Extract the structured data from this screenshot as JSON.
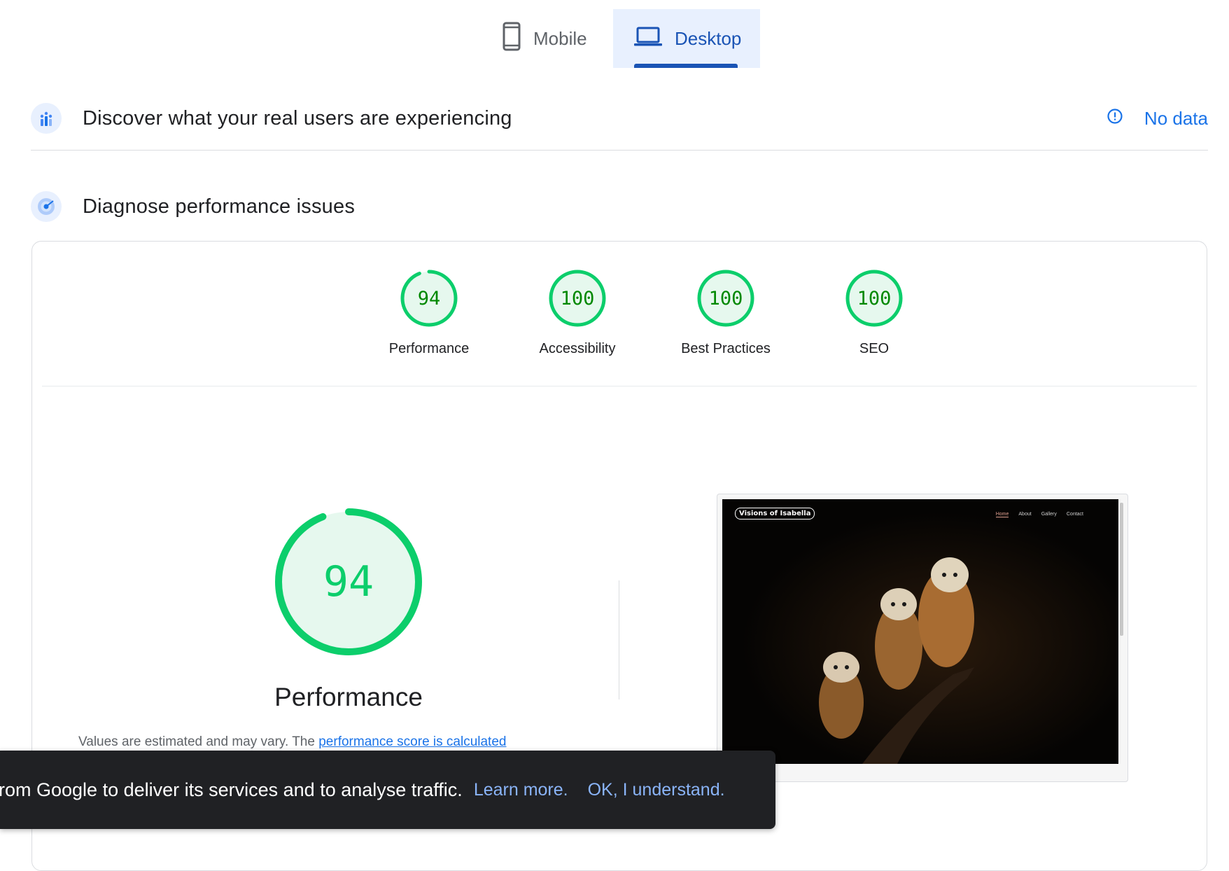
{
  "device_tabs": {
    "mobile_label": "Mobile",
    "desktop_label": "Desktop",
    "active": "Desktop",
    "icons": {
      "mobile": "smartphone-icon",
      "desktop": "laptop-icon"
    }
  },
  "crux": {
    "title": "Discover what your real users are experiencing",
    "status_text": "No data",
    "icons": {
      "section": "bar-chart-people-icon",
      "status": "info-icon"
    }
  },
  "diagnose": {
    "title": "Diagnose performance issues",
    "icon": "radar-icon"
  },
  "categories": [
    {
      "score": "94",
      "label": "Performance",
      "fraction": 0.94
    },
    {
      "score": "100",
      "label": "Accessibility",
      "fraction": 1.0
    },
    {
      "score": "100",
      "label": "Best Practices",
      "fraction": 1.0
    },
    {
      "score": "100",
      "label": "SEO",
      "fraction": 1.0
    }
  ],
  "performance": {
    "score": "94",
    "fraction": 0.94,
    "title": "Performance",
    "note_prefix": "Values are estimated and may vary. The ",
    "note_link": "performance score is calculated"
  },
  "thumbnail": {
    "site_title": "Visions of Isabella",
    "nav": [
      "Home",
      "About",
      "Gallery",
      "Contact"
    ],
    "active_nav": "Home"
  },
  "cookie": {
    "text": "rom Google to deliver its services and to analyse traffic.",
    "learn_more": "Learn more.",
    "ok": "OK, I understand."
  },
  "colors": {
    "pass_green": "#0cce6b",
    "pass_text": "#008800",
    "pass_fill": "#e6f8ee",
    "accent_blue": "#1a73e8",
    "tab_blue": "#1a54b5"
  }
}
